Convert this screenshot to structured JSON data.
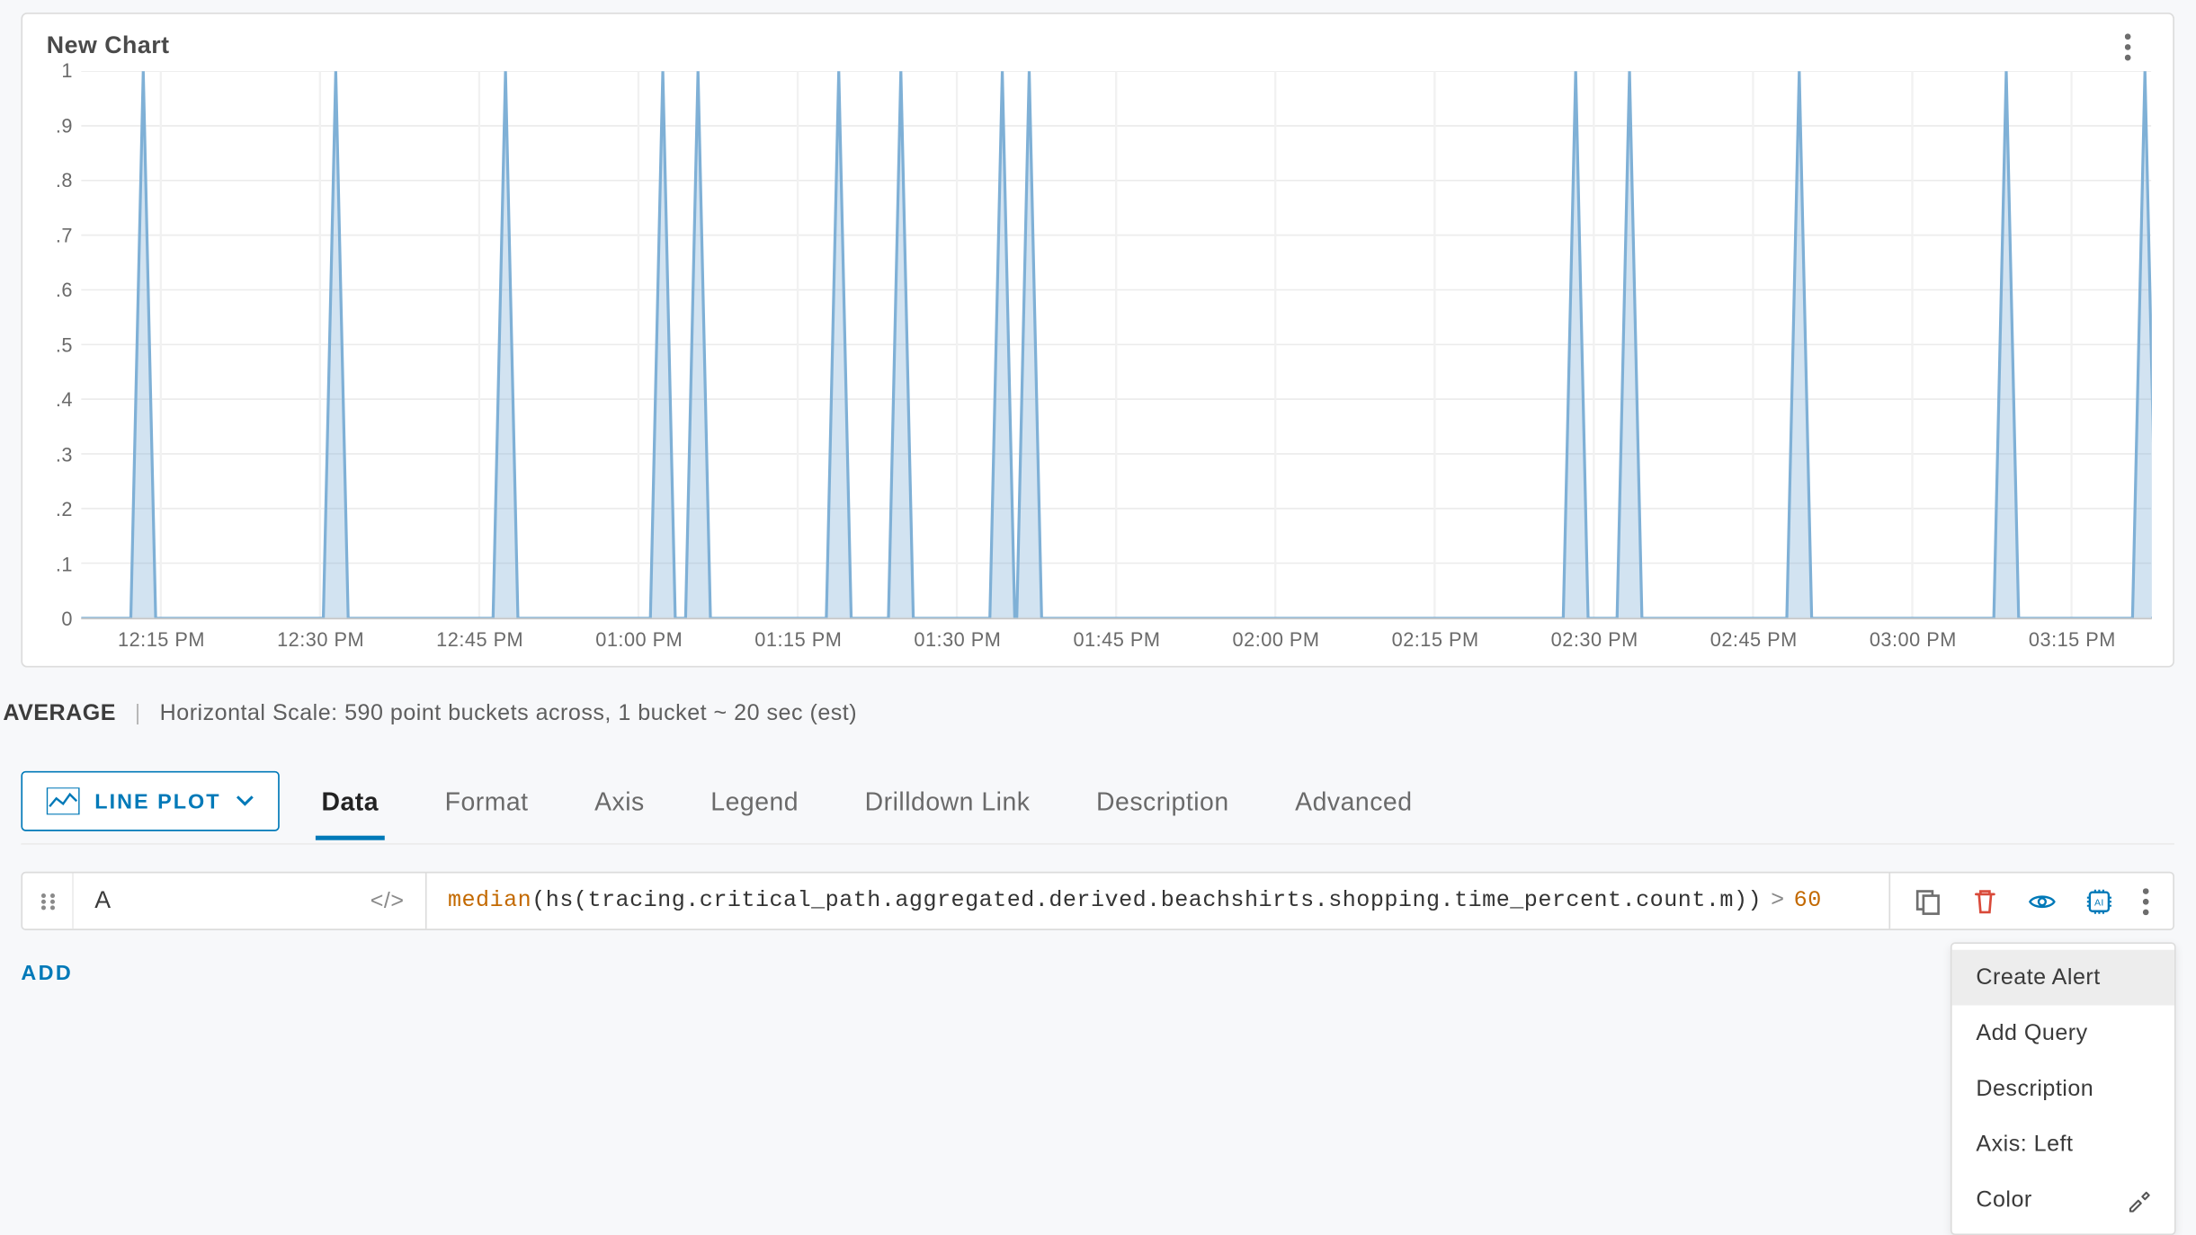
{
  "chart": {
    "title": "New Chart",
    "summary_metric": "AVERAGE",
    "scale_label": "Horizontal Scale: 590 point buckets across, 1 bucket ~ 20 sec (est)"
  },
  "chart_data": {
    "type": "line",
    "ylabel": "",
    "xlabel": "",
    "ylim": [
      0,
      1
    ],
    "y_ticks": [
      "1",
      ".9",
      ".8",
      ".7",
      ".6",
      ".5",
      ".4",
      ".3",
      ".2",
      ".1",
      "0"
    ],
    "x_ticks": [
      "12:15 PM",
      "12:30 PM",
      "12:45 PM",
      "01:00 PM",
      "01:15 PM",
      "01:30 PM",
      "01:45 PM",
      "02:00 PM",
      "02:15 PM",
      "02:30 PM",
      "02:45 PM",
      "03:00 PM",
      "03:15 PM"
    ],
    "spike_positions_frac": [
      0.035,
      0.145,
      0.24,
      0.33,
      0.35,
      0.43,
      0.465,
      0.522,
      0.538,
      0.848,
      0.88,
      0.975,
      1.095,
      1.175
    ],
    "spike_positions_frac_of_width": [
      0.03,
      0.123,
      0.205,
      0.281,
      0.298,
      0.366,
      0.396,
      0.445,
      0.458,
      0.722,
      0.748,
      0.83,
      0.93,
      0.997
    ],
    "spike_value": 1,
    "baseline_value": 0
  },
  "plot_type": {
    "label": "LINE PLOT"
  },
  "tabs": [
    {
      "id": "data",
      "label": "Data",
      "active": true
    },
    {
      "id": "format",
      "label": "Format",
      "active": false
    },
    {
      "id": "axis",
      "label": "Axis",
      "active": false
    },
    {
      "id": "legend",
      "label": "Legend",
      "active": false
    },
    {
      "id": "drilldown",
      "label": "Drilldown Link",
      "active": false
    },
    {
      "id": "description",
      "label": "Description",
      "active": false
    },
    {
      "id": "advanced",
      "label": "Advanced",
      "active": false
    }
  ],
  "query": {
    "name": "A",
    "fn": "median",
    "inner_fn": "hs",
    "metric": "tracing.critical_path.aggregated.derived.beachshirts.shopping.time_percent.count.m",
    "operator": ">",
    "threshold": "60"
  },
  "add_label": "ADD",
  "dropdown": {
    "items": [
      {
        "id": "create-alert",
        "label": "Create Alert",
        "hover": true
      },
      {
        "id": "add-query",
        "label": "Add Query"
      },
      {
        "id": "description",
        "label": "Description"
      },
      {
        "id": "axis-left",
        "label": "Axis: Left"
      },
      {
        "id": "color",
        "label": "Color",
        "icon": "eyedropper"
      }
    ]
  }
}
